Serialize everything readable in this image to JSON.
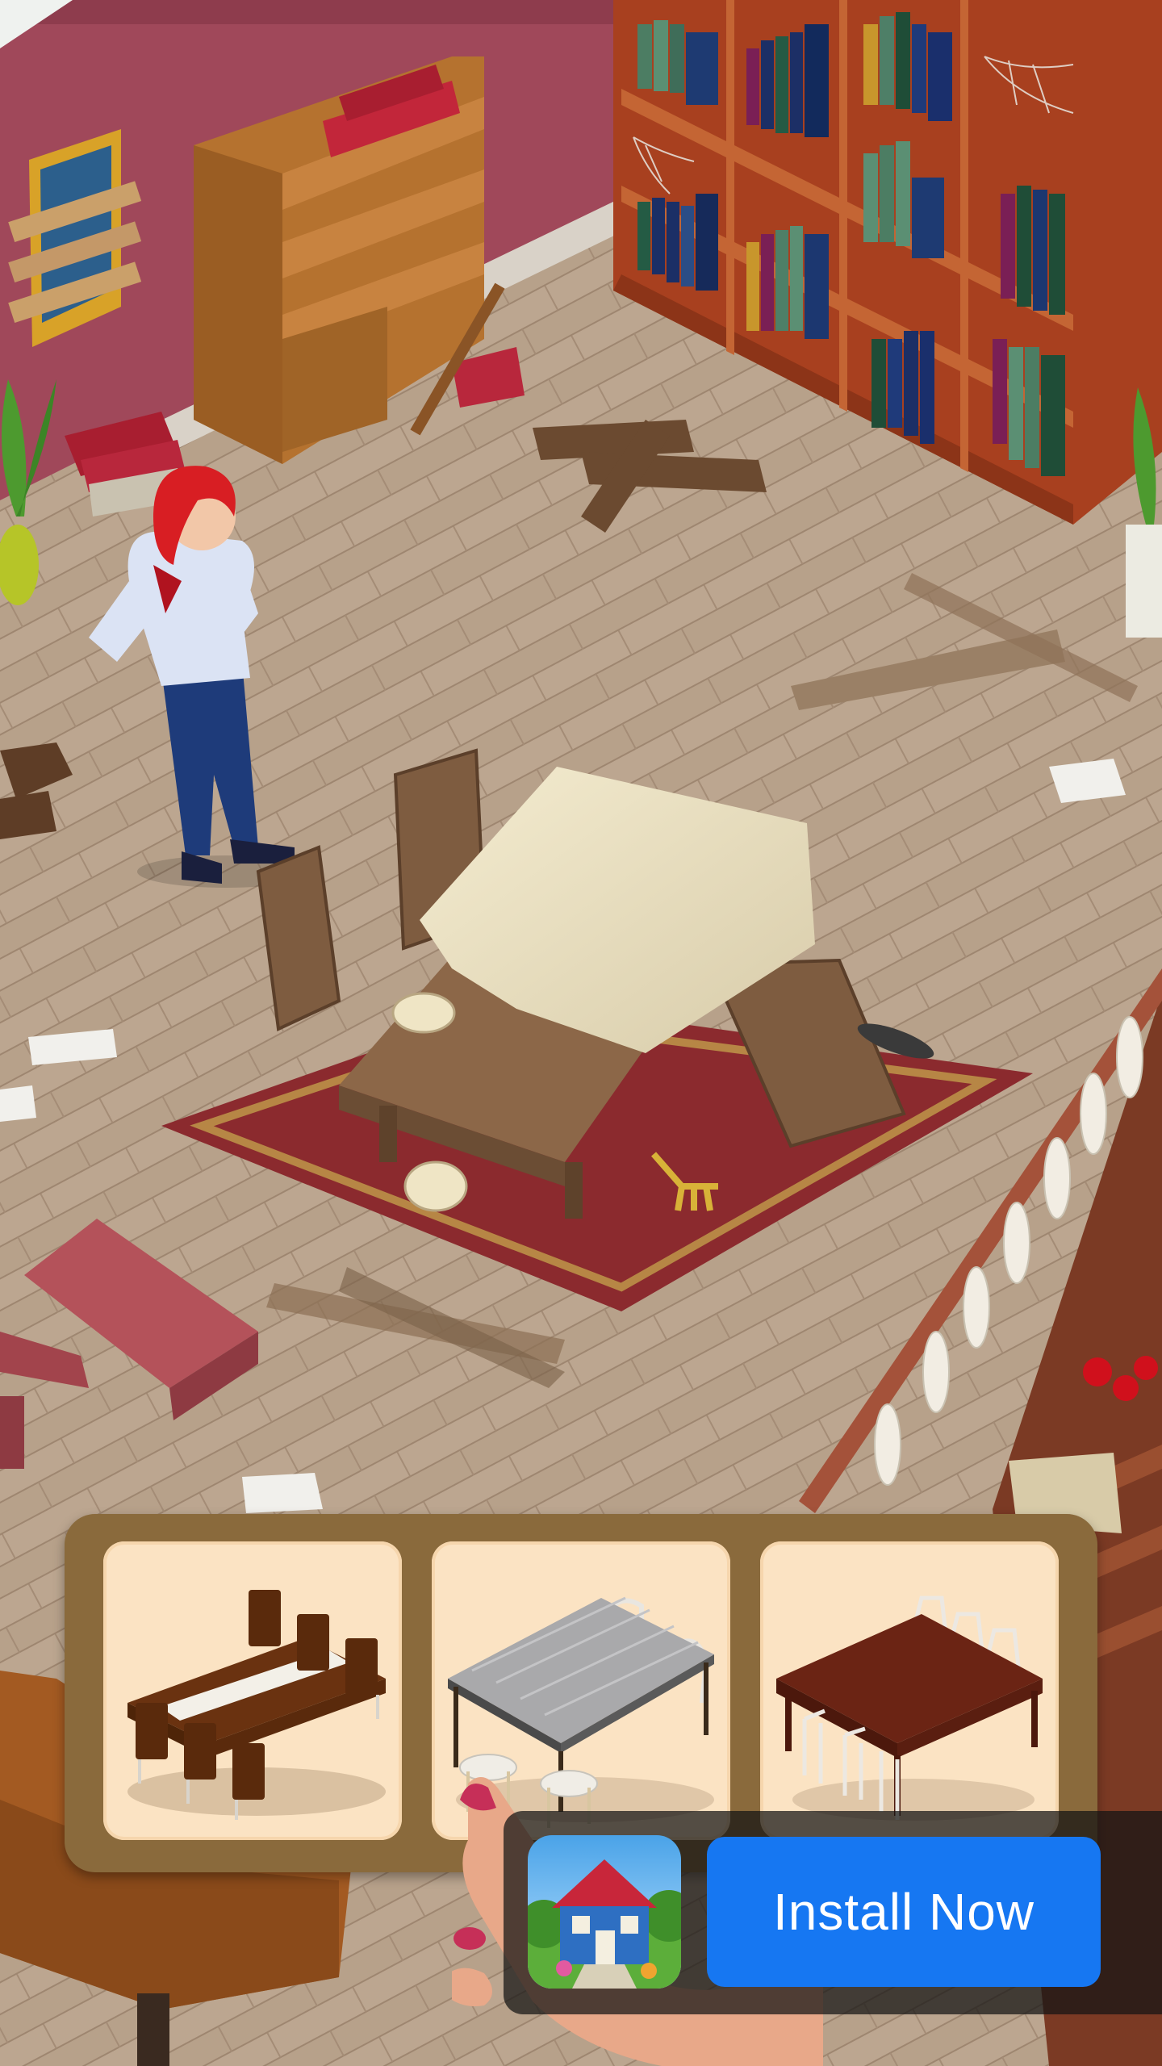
{
  "scene": {
    "description_hidden": "",
    "choices": [
      {
        "id": "dining-option-1",
        "label": "",
        "tone": "dark-wood-with-white-runner"
      },
      {
        "id": "dining-option-2",
        "label": "",
        "tone": "white-wood"
      },
      {
        "id": "dining-option-3",
        "label": "",
        "tone": "mahogany-with-white-chairs"
      }
    ]
  },
  "ad": {
    "install_label": "Install Now",
    "button_color": "#1677f2"
  },
  "icons": {
    "app": "house-app-icon",
    "hand": "pointer-hand"
  }
}
